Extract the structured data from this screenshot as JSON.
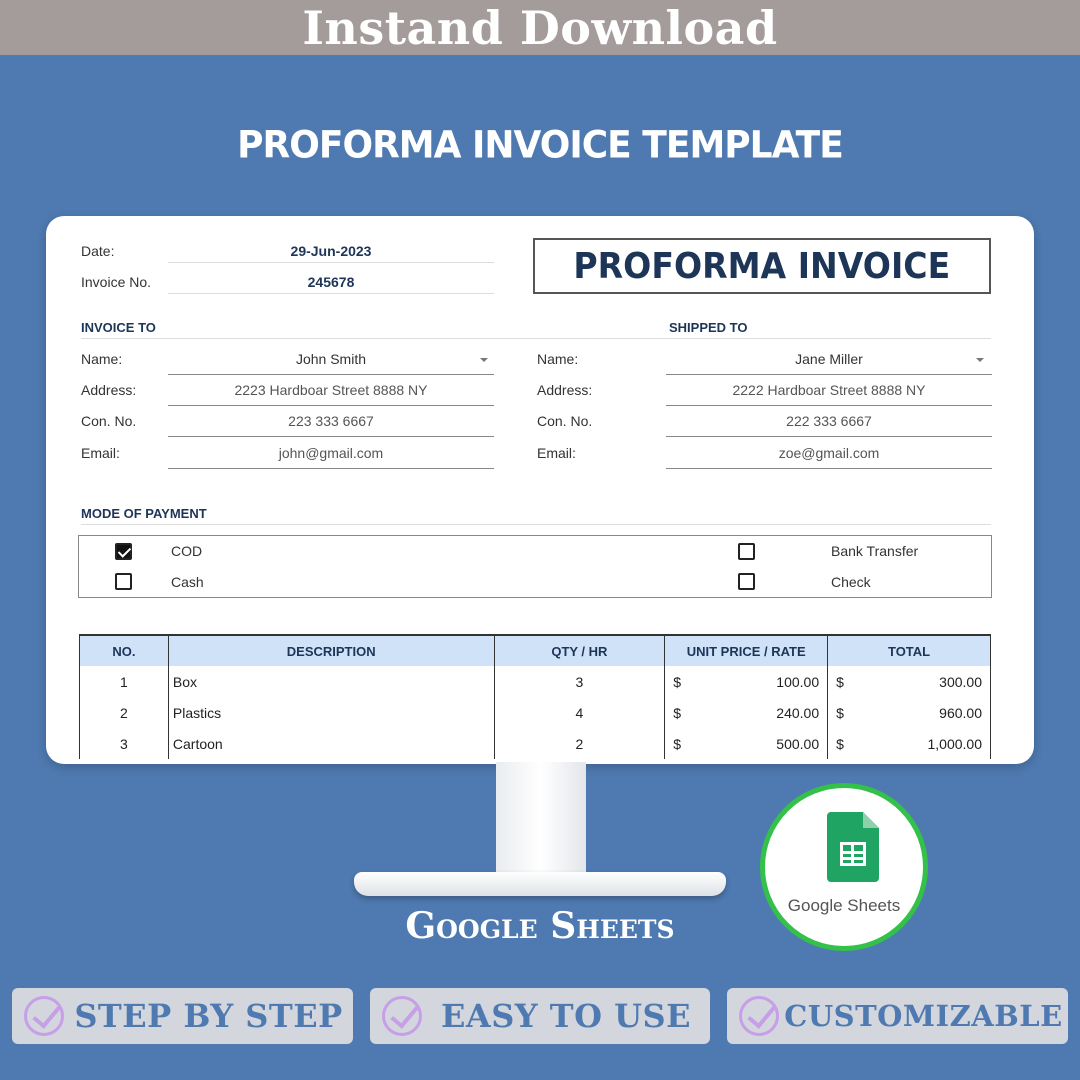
{
  "banner": {
    "text": "Instand Download"
  },
  "subtitle": "PROFORMA INVOICE TEMPLATE",
  "stand_label": "Google Sheets",
  "invoice": {
    "date_label": "Date:",
    "date_value": "29-Jun-2023",
    "invoice_no_label": "Invoice No.",
    "invoice_no_value": "245678",
    "title": "PROFORMA INVOICE",
    "invoice_to": {
      "heading": "INVOICE TO",
      "name_label": "Name:",
      "name": "John Smith",
      "address_label": "Address:",
      "address": "2223 Hardboar Street 8888 NY",
      "contact_label": "Con. No.",
      "contact": "223 333 6667",
      "email_label": "Email:",
      "email": "john@gmail.com"
    },
    "shipped_to": {
      "heading": "SHIPPED TO",
      "name_label": "Name:",
      "name": "Jane Miller",
      "address_label": "Address:",
      "address": "2222 Hardboar Street 8888 NY",
      "contact_label": "Con. No.",
      "contact": "222 333 6667",
      "email_label": "Email:",
      "email": "zoe@gmail.com"
    },
    "payment": {
      "heading": "MODE OF PAYMENT",
      "options": [
        {
          "label": "COD",
          "checked": true
        },
        {
          "label": "Cash",
          "checked": false
        },
        {
          "label": "Bank Transfer",
          "checked": false
        },
        {
          "label": "Check",
          "checked": false
        }
      ]
    },
    "table": {
      "headers": [
        "NO.",
        "DESCRIPTION",
        "QTY / HR",
        "UNIT PRICE / RATE",
        "TOTAL"
      ],
      "currency": "$",
      "rows": [
        {
          "no": "1",
          "desc": "Box",
          "qty": "3",
          "price": "100.00",
          "total": "300.00"
        },
        {
          "no": "2",
          "desc": "Plastics",
          "qty": "4",
          "price": "240.00",
          "total": "960.00"
        },
        {
          "no": "3",
          "desc": "Cartoon",
          "qty": "2",
          "price": "500.00",
          "total": "1,000.00"
        }
      ]
    }
  },
  "badge": {
    "text": "Google Sheets"
  },
  "features": [
    "STEP BY STEP",
    "EASY TO USE",
    "CUSTOMIZABLE"
  ],
  "colors": {
    "background": "#4e7ab1",
    "banner": "#a49b9b",
    "header_fill": "#cfe2f8",
    "title_blue": "#1d3557",
    "badge_ring": "#33c14a",
    "check_purple": "#c79ee8"
  }
}
